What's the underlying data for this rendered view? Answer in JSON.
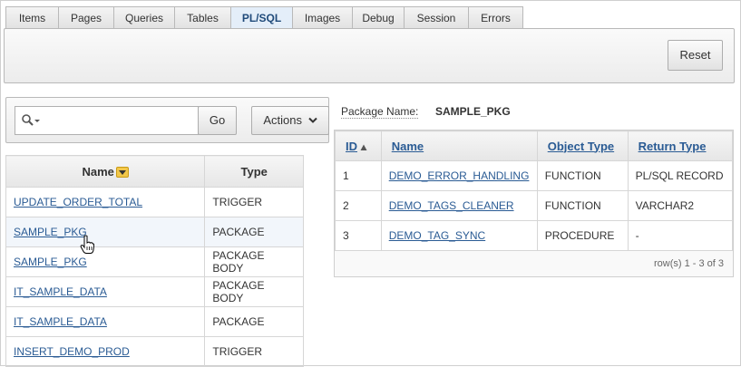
{
  "tabs": [
    {
      "label": "Items"
    },
    {
      "label": "Pages"
    },
    {
      "label": "Queries"
    },
    {
      "label": "Tables"
    },
    {
      "label": "PL/SQL",
      "active": true
    },
    {
      "label": "Images"
    },
    {
      "label": "Debug"
    },
    {
      "label": "Session"
    },
    {
      "label": "Errors"
    }
  ],
  "toolbar": {
    "reset_label": "Reset"
  },
  "search": {
    "value": "",
    "placeholder": "",
    "go_label": "Go",
    "actions_label": "Actions"
  },
  "objects_table": {
    "headers": [
      "Name",
      "Type"
    ],
    "rows": [
      {
        "name": "UPDATE_ORDER_TOTAL",
        "type": "TRIGGER"
      },
      {
        "name": "SAMPLE_PKG",
        "type": "PACKAGE"
      },
      {
        "name": "SAMPLE_PKG",
        "type": "PACKAGE BODY"
      },
      {
        "name": "IT_SAMPLE_DATA",
        "type": "PACKAGE BODY"
      },
      {
        "name": "IT_SAMPLE_DATA",
        "type": "PACKAGE"
      },
      {
        "name": "INSERT_DEMO_PROD",
        "type": "TRIGGER"
      }
    ]
  },
  "package": {
    "label": "Package Name:",
    "value": "SAMPLE_PKG"
  },
  "members_table": {
    "headers": [
      "ID",
      "Name",
      "Object Type",
      "Return Type"
    ],
    "rows": [
      {
        "id": "1",
        "name": "DEMO_ERROR_HANDLING",
        "object_type": "FUNCTION",
        "return_type": "PL/SQL RECORD"
      },
      {
        "id": "2",
        "name": "DEMO_TAGS_CLEANER",
        "object_type": "FUNCTION",
        "return_type": "VARCHAR2"
      },
      {
        "id": "3",
        "name": "DEMO_TAG_SYNC",
        "object_type": "PROCEDURE",
        "return_type": "-"
      }
    ],
    "footer": "row(s) 1 - 3 of 3"
  },
  "icons": {
    "search": "search-icon",
    "sort": "sort-desc-icon",
    "chevron": "chevron-down-icon",
    "cursor": "hand-pointer-icon"
  },
  "colors": {
    "link": "#2a5b94",
    "active_tab_bg": "#e4eef9",
    "sort_badge": "#f2c74a"
  }
}
